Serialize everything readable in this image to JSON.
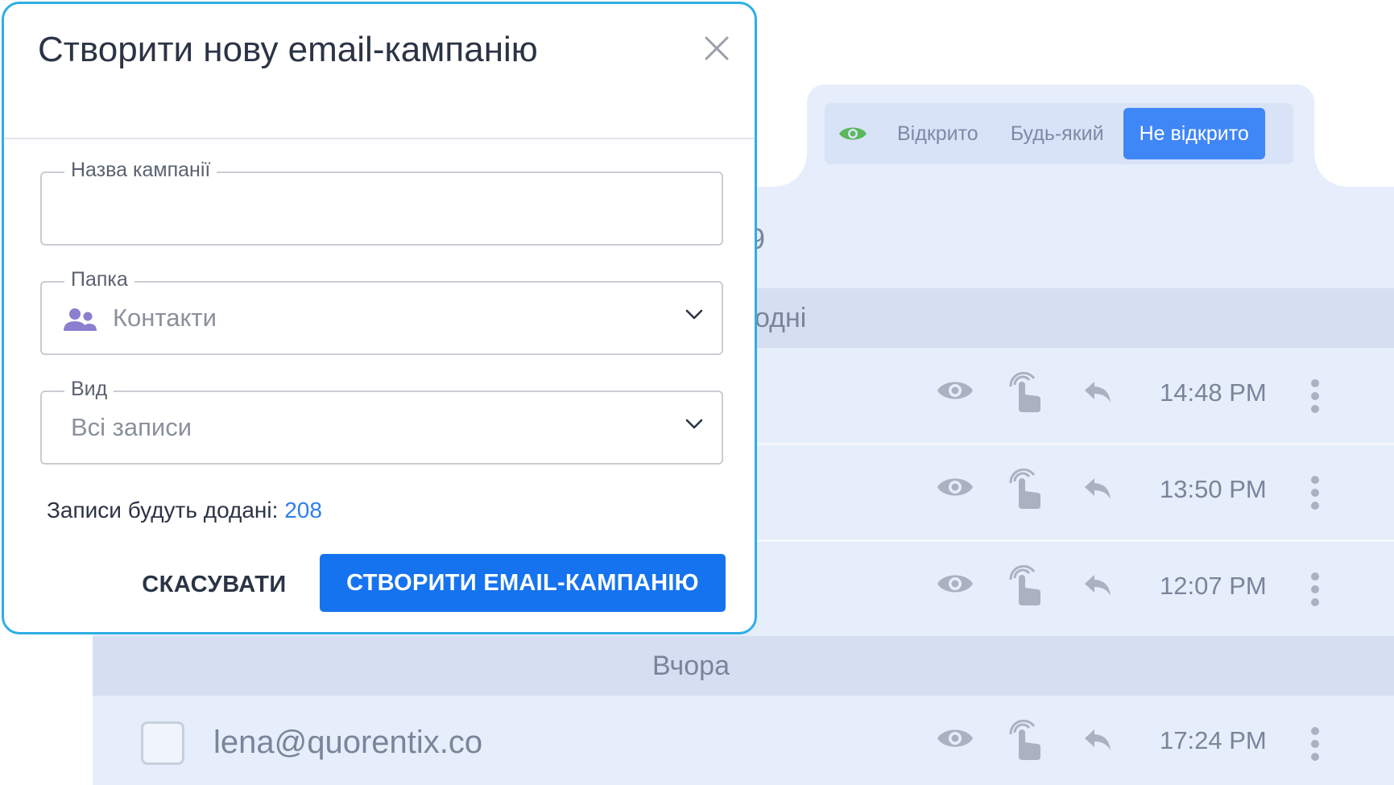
{
  "filter_tabs": {
    "open": "Відкрито",
    "any": "Будь-який",
    "not_open": "Не відкрито",
    "active": "not_open"
  },
  "list": {
    "partial_count": "9",
    "group_today": "одні",
    "group_yesterday": "Вчора",
    "rows": [
      {
        "time": "14:48 PM",
        "email": ""
      },
      {
        "time": "13:50 PM",
        "email": ""
      },
      {
        "time": "12:07 PM",
        "email": ""
      },
      {
        "time": "17:24 PM",
        "email": "lena@quorentix.co"
      }
    ]
  },
  "modal": {
    "title": "Створити нову email-кампанію",
    "campaign_name": {
      "label": "Назва кампанії",
      "value": ""
    },
    "folder": {
      "label": "Папка",
      "value": "Контакти"
    },
    "view": {
      "label": "Вид",
      "value": "Всі записи"
    },
    "records_label": "Записи будуть додані: ",
    "records_count": "208",
    "cancel_label": "СКАСУВАТИ",
    "create_label": "СТВОРИТИ EMAIL-КАМПАНІЮ"
  },
  "colors": {
    "accent": "#1673f0",
    "modal_border": "#2eaee6",
    "tab_active": "#3f86f7",
    "panel_bg": "#e6edfb",
    "group_bg": "#d6dff2",
    "eye_green": "#5cb85c",
    "folder_icon": "#8b7fd0"
  },
  "icons": {
    "filter": "eye-icon",
    "close": "close-icon",
    "folder": "contacts-icon",
    "dropdown": "chevron-down-icon",
    "opened": "eye-icon",
    "clicked": "tap-icon",
    "replied": "reply-icon",
    "more": "more-vertical-icon"
  }
}
